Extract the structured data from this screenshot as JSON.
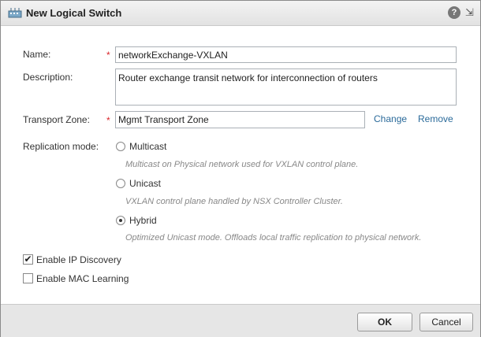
{
  "dialog": {
    "title": "New Logical Switch",
    "help_icon": "?",
    "expand_icon": "⇲"
  },
  "form": {
    "name_label": "Name:",
    "name_value": "networkExchange-VXLAN",
    "required_mark": "*",
    "description_label": "Description:",
    "description_value": "Router exchange transit network for interconnection of routers",
    "transport_zone_label": "Transport Zone:",
    "transport_zone_value": "Mgmt Transport Zone",
    "change_link": "Change",
    "remove_link": "Remove",
    "replication_mode_label": "Replication mode:",
    "replication_options": [
      {
        "label": "Multicast",
        "hint": "Multicast on Physical network used for VXLAN control plane.",
        "selected": false
      },
      {
        "label": "Unicast",
        "hint": "VXLAN control plane handled by NSX Controller Cluster.",
        "selected": false
      },
      {
        "label": "Hybrid",
        "hint": "Optimized Unicast mode. Offloads local traffic replication to physical network.",
        "selected": true
      }
    ],
    "enable_ip_discovery_label": "Enable IP Discovery",
    "enable_ip_discovery_checked": true,
    "enable_mac_learning_label": "Enable MAC Learning",
    "enable_mac_learning_checked": false,
    "check_mark": "✔"
  },
  "footer": {
    "ok_label": "OK",
    "cancel_label": "Cancel"
  },
  "icons": {
    "title_icon": "logical-switch-icon",
    "help": "help-icon",
    "expand": "expand-icon"
  }
}
